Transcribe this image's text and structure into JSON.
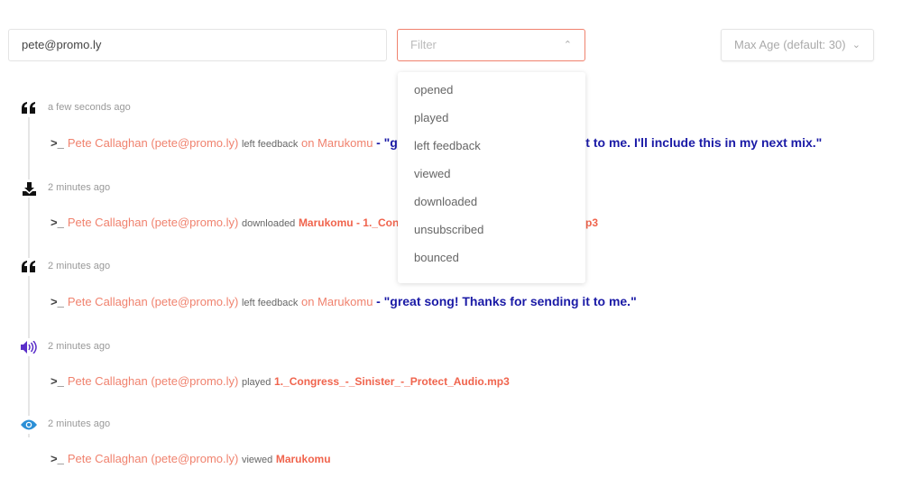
{
  "search": {
    "value": "pete@promo.ly"
  },
  "filter": {
    "placeholder": "Filter",
    "options": [
      "opened",
      "played",
      "left feedback",
      "viewed",
      "downloaded",
      "unsubscribed",
      "bounced"
    ]
  },
  "max_age": {
    "placeholder": "Max Age (default: 30)"
  },
  "colors": {
    "accent": "#f0826e",
    "object": "#f0644d",
    "quote": "#1a1aa6",
    "played_icon": "#5b2fc9",
    "viewed_icon": "#2b8fd6"
  },
  "events": [
    {
      "icon": "quote-icon",
      "time": "a few seconds ago",
      "user": "Pete Callaghan (pete@promo.ly)",
      "verb": "left feedback",
      "object": "on Marukomu",
      "quote": "- \"great song! Thanks for sending it to me. I'll include this in my next mix.\""
    },
    {
      "icon": "download-icon",
      "time": "2 minutes ago",
      "user": "Pete Callaghan (pete@promo.ly)",
      "verb": "downloaded",
      "object": "Marukomu - 1._Congress_-_Sinister_-_Protect_Audio.mp3",
      "quote": ""
    },
    {
      "icon": "quote-icon",
      "time": "2 minutes ago",
      "user": "Pete Callaghan (pete@promo.ly)",
      "verb": "left feedback",
      "object": "on Marukomu",
      "quote": "- \"great song! Thanks for sending it to me.\""
    },
    {
      "icon": "volume-icon",
      "time": "2 minutes ago",
      "user": "Pete Callaghan (pete@promo.ly)",
      "verb": "played",
      "object": "1._Congress_-_Sinister_-_Protect_Audio.mp3",
      "quote": ""
    },
    {
      "icon": "eye-icon",
      "time": "2 minutes ago",
      "user": "Pete Callaghan (pete@promo.ly)",
      "verb": "viewed",
      "object": "Marukomu",
      "quote": ""
    }
  ]
}
